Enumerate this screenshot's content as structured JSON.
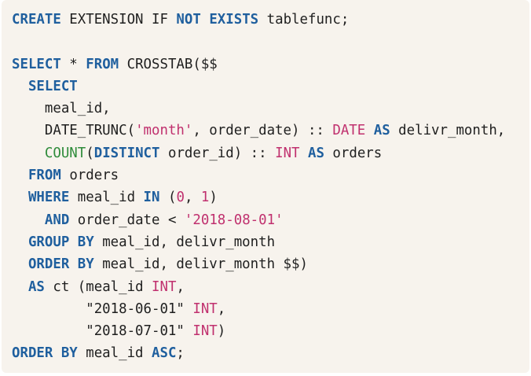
{
  "colors": {
    "background": "#f7f3ed",
    "keyword": "#1f5f9e",
    "plain": "#1f1f1f",
    "string": "#c0306e",
    "number": "#c0306e",
    "type": "#c0306e",
    "function": "#2e8b3a"
  },
  "code": {
    "lines": [
      [
        {
          "t": "kw",
          "v": "CREATE"
        },
        {
          "t": "plain",
          "v": " EXTENSION IF "
        },
        {
          "t": "kw",
          "v": "NOT"
        },
        {
          "t": "plain",
          "v": " "
        },
        {
          "t": "kw",
          "v": "EXISTS"
        },
        {
          "t": "plain",
          "v": " tablefunc;"
        }
      ],
      [],
      [
        {
          "t": "kw",
          "v": "SELECT"
        },
        {
          "t": "plain",
          "v": " * "
        },
        {
          "t": "kw",
          "v": "FROM"
        },
        {
          "t": "plain",
          "v": " CROSSTAB($$"
        }
      ],
      [
        {
          "t": "plain",
          "v": "  "
        },
        {
          "t": "kw",
          "v": "SELECT"
        }
      ],
      [
        {
          "t": "plain",
          "v": "    meal_id,"
        }
      ],
      [
        {
          "t": "plain",
          "v": "    DATE_TRUNC("
        },
        {
          "t": "str",
          "v": "'month'"
        },
        {
          "t": "plain",
          "v": ", order_date) :: "
        },
        {
          "t": "type",
          "v": "DATE"
        },
        {
          "t": "plain",
          "v": " "
        },
        {
          "t": "kw",
          "v": "AS"
        },
        {
          "t": "plain",
          "v": " delivr_month,"
        }
      ],
      [
        {
          "t": "plain",
          "v": "    "
        },
        {
          "t": "fn",
          "v": "COUNT"
        },
        {
          "t": "plain",
          "v": "("
        },
        {
          "t": "kw",
          "v": "DISTINCT"
        },
        {
          "t": "plain",
          "v": " order_id) :: "
        },
        {
          "t": "type",
          "v": "INT"
        },
        {
          "t": "plain",
          "v": " "
        },
        {
          "t": "kw",
          "v": "AS"
        },
        {
          "t": "plain",
          "v": " orders"
        }
      ],
      [
        {
          "t": "plain",
          "v": "  "
        },
        {
          "t": "kw",
          "v": "FROM"
        },
        {
          "t": "plain",
          "v": " orders"
        }
      ],
      [
        {
          "t": "plain",
          "v": "  "
        },
        {
          "t": "kw",
          "v": "WHERE"
        },
        {
          "t": "plain",
          "v": " meal_id "
        },
        {
          "t": "kw",
          "v": "IN"
        },
        {
          "t": "plain",
          "v": " ("
        },
        {
          "t": "num",
          "v": "0"
        },
        {
          "t": "plain",
          "v": ", "
        },
        {
          "t": "num",
          "v": "1"
        },
        {
          "t": "plain",
          "v": ")"
        }
      ],
      [
        {
          "t": "plain",
          "v": "    "
        },
        {
          "t": "kw",
          "v": "AND"
        },
        {
          "t": "plain",
          "v": " order_date < "
        },
        {
          "t": "str",
          "v": "'2018-08-01'"
        }
      ],
      [
        {
          "t": "plain",
          "v": "  "
        },
        {
          "t": "kw",
          "v": "GROUP BY"
        },
        {
          "t": "plain",
          "v": " meal_id, delivr_month"
        }
      ],
      [
        {
          "t": "plain",
          "v": "  "
        },
        {
          "t": "kw",
          "v": "ORDER BY"
        },
        {
          "t": "plain",
          "v": " meal_id, delivr_month $$)"
        }
      ],
      [
        {
          "t": "plain",
          "v": "  "
        },
        {
          "t": "kw",
          "v": "AS"
        },
        {
          "t": "plain",
          "v": " ct (meal_id "
        },
        {
          "t": "type",
          "v": "INT"
        },
        {
          "t": "plain",
          "v": ","
        }
      ],
      [
        {
          "t": "plain",
          "v": "         \"2018-06-01\" "
        },
        {
          "t": "type",
          "v": "INT"
        },
        {
          "t": "plain",
          "v": ","
        }
      ],
      [
        {
          "t": "plain",
          "v": "         \"2018-07-01\" "
        },
        {
          "t": "type",
          "v": "INT"
        },
        {
          "t": "plain",
          "v": ")"
        }
      ],
      [
        {
          "t": "kw",
          "v": "ORDER BY"
        },
        {
          "t": "plain",
          "v": " meal_id "
        },
        {
          "t": "kw",
          "v": "ASC"
        },
        {
          "t": "plain",
          "v": ";"
        }
      ]
    ]
  }
}
